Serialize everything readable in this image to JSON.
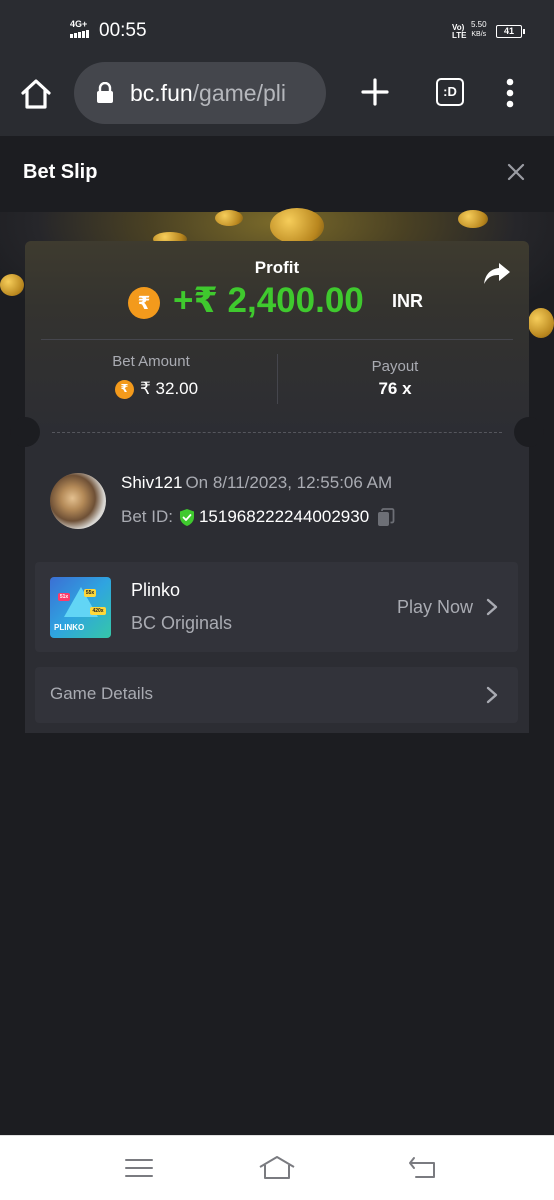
{
  "status_bar": {
    "network": "4G+",
    "time": "00:55",
    "volte": "Vo) LTE",
    "speed_value": "5.50",
    "speed_unit": "KB/s",
    "battery": "41"
  },
  "browser": {
    "url_domain": "bc.fun",
    "url_path": "/game/pli",
    "tabs_label": ":D",
    "icons": [
      "home-icon",
      "lock-icon",
      "plus-icon",
      "tabs-icon",
      "more-vertical-icon"
    ]
  },
  "slip": {
    "title": "Bet Slip",
    "profit_label": "Profit",
    "profit_amount": "+₹ 2,400.00",
    "profit_currency": "INR",
    "currency_symbol": "₹",
    "bet_amount_label": "Bet Amount",
    "bet_amount_value": "₹ 32.00",
    "payout_label": "Payout",
    "payout_value": "76 x"
  },
  "bet": {
    "username": "Shiv121",
    "date": "On 8/11/2023, 12:55:06 AM",
    "bet_id_label": "Bet ID:",
    "bet_id": "151968222244002930"
  },
  "game": {
    "name": "Plinko",
    "provider": "BC Originals",
    "play_label": "Play Now",
    "thumb_text": "PLINKO",
    "thumb_chips": [
      "51x",
      "55x",
      "420x"
    ]
  },
  "details": {
    "label": "Game Details"
  },
  "colors": {
    "profit_green": "#3fc92e",
    "coin_orange": "#f39a1c",
    "background": "#1c1d21",
    "card": "#2c2d33"
  }
}
